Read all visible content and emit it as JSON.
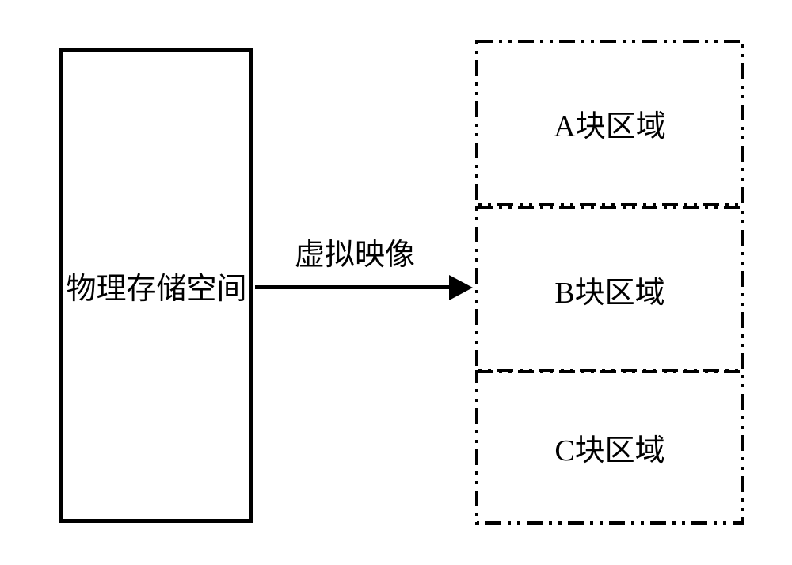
{
  "diagram": {
    "left_box": {
      "label": "物理存储空间"
    },
    "arrow": {
      "label": "虚拟映像"
    },
    "regions": {
      "a": {
        "label": "A块区域"
      },
      "b": {
        "label": "B块区域"
      },
      "c": {
        "label": "C块区域"
      }
    }
  }
}
